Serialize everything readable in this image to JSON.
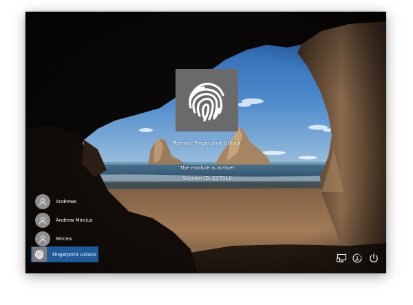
{
  "lock_screen": {
    "credential_provider_title": "Remote Fingerprint Unlock",
    "status_message": "The module is active!",
    "session_label": "Session ID: 237910"
  },
  "user_list": [
    {
      "name": "Andrews",
      "icon": "user-silhouette-icon"
    },
    {
      "name": "Andrew Mircius",
      "icon": "user-silhouette-icon"
    },
    {
      "name": "Mircea",
      "icon": "user-silhouette-icon"
    }
  ],
  "selected_tile": {
    "label": "Fingerprint Unlock",
    "icon": "fingerprint-icon",
    "highlight_color": "#1f5a9a"
  },
  "system_buttons": [
    {
      "name": "network",
      "icon": "network-icon"
    },
    {
      "name": "ease-of-access",
      "icon": "ease-of-access-icon"
    },
    {
      "name": "power",
      "icon": "power-icon"
    }
  ]
}
